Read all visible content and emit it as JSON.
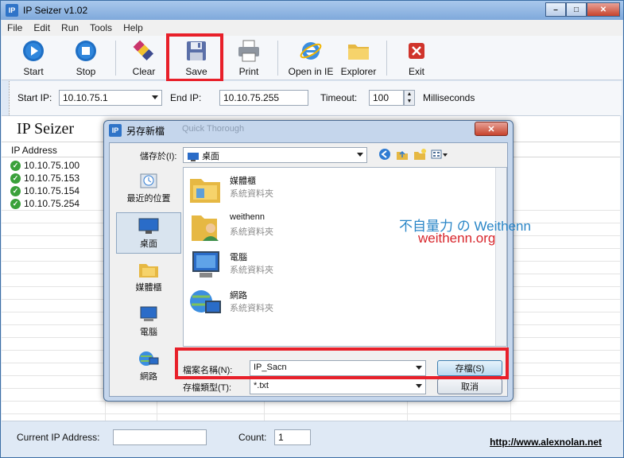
{
  "window": {
    "title": "IP Seizer v1.02",
    "icon_text": "IP"
  },
  "menu": [
    "File",
    "Edit",
    "Run",
    "Tools",
    "Help"
  ],
  "toolbar": {
    "start": "Start",
    "stop": "Stop",
    "clear": "Clear",
    "save": "Save",
    "print": "Print",
    "open_ie": "Open in IE",
    "explorer": "Explorer",
    "exit": "Exit"
  },
  "ip_range": {
    "start_label": "Start IP:",
    "start_value": "10.10.75.1",
    "end_label": "End IP:",
    "end_value": "10.10.75.255",
    "timeout_label": "Timeout:",
    "timeout_value": "100",
    "unit": "Milliseconds"
  },
  "main": {
    "heading": "IP Seizer",
    "column_header": "IP Address",
    "ips": [
      "10.10.75.100",
      "10.10.75.153",
      "10.10.75.154",
      "10.10.75.254"
    ]
  },
  "status": {
    "current_label": "Current IP Address:",
    "current_value": "",
    "count_label": "Count:",
    "count_value": "1",
    "link": "http://www.alexnolan.net"
  },
  "dialog": {
    "title": "另存新檔",
    "icon_text": "IP",
    "ghost_text": "Quick    Thorough",
    "save_in_label": "儲存於(I):",
    "save_in_value": "桌面",
    "places": [
      "最近的位置",
      "桌面",
      "媒體櫃",
      "電腦",
      "網路"
    ],
    "files": [
      {
        "name": "媒體櫃",
        "type": "系統資料夾"
      },
      {
        "name": "weithenn",
        "type": "系統資料夾"
      },
      {
        "name": "電腦",
        "type": "系統資料夾"
      },
      {
        "name": "網路",
        "type": "系統資料夾"
      }
    ],
    "filename_label": "檔案名稱(N):",
    "filename_value": "IP_Sacn",
    "filetype_label": "存檔類型(T):",
    "filetype_value": "*.txt",
    "save_button": "存檔(S)",
    "cancel_button": "取消"
  },
  "watermark": {
    "line1": "不自量力 の Weithenn",
    "line2": "weithenn.org"
  },
  "colors": {
    "highlight": "#e8202a",
    "accent": "#2f74c8"
  }
}
